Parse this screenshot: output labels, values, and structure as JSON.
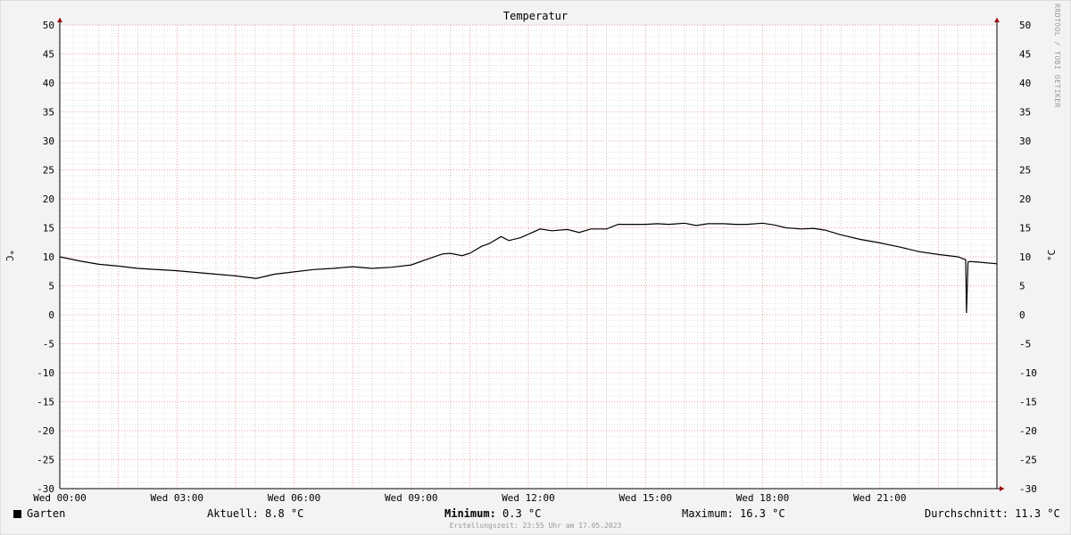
{
  "chart_data": {
    "type": "line",
    "title": "Temperatur",
    "ylabel": "°C",
    "ylim": [
      -30,
      50
    ],
    "yticks": [
      50,
      45,
      40,
      35,
      30,
      25,
      20,
      15,
      10,
      5,
      0,
      -5,
      -10,
      -15,
      -20,
      -25,
      -30
    ],
    "xlim": [
      0,
      24
    ],
    "xticks": [
      {
        "hour": 0,
        "label": "Wed 00:00"
      },
      {
        "hour": 3,
        "label": "Wed 03:00"
      },
      {
        "hour": 6,
        "label": "Wed 06:00"
      },
      {
        "hour": 9,
        "label": "Wed 09:00"
      },
      {
        "hour": 12,
        "label": "Wed 12:00"
      },
      {
        "hour": 15,
        "label": "Wed 15:00"
      },
      {
        "hour": 18,
        "label": "Wed 18:00"
      },
      {
        "hour": 21,
        "label": "Wed 21:00"
      }
    ],
    "grid": true,
    "series": [
      {
        "name": "Garten",
        "color": "#000000",
        "x": [
          0,
          0.5,
          1,
          1.5,
          2,
          3,
          4,
          4.5,
          5,
          5.05,
          5.5,
          6,
          6.5,
          7,
          7.5,
          8,
          8.5,
          9,
          9.5,
          9.8,
          10,
          10.3,
          10.5,
          10.8,
          11,
          11.3,
          11.5,
          11.8,
          12,
          12.3,
          12.6,
          13,
          13.3,
          13.6,
          14,
          14.3,
          14.6,
          15,
          15.3,
          15.6,
          16,
          16.3,
          16.6,
          17,
          17.3,
          17.6,
          18,
          18.3,
          18.6,
          19,
          19.3,
          19.6,
          20,
          20.5,
          21,
          21.5,
          22,
          22.5,
          23,
          23.2,
          23.22,
          23.26,
          23.3,
          23.5,
          24
        ],
        "values": [
          10,
          9.3,
          8.7,
          8.4,
          8.0,
          7.6,
          7.0,
          6.7,
          6.3,
          6.3,
          7.0,
          7.4,
          7.8,
          8.0,
          8.3,
          8.0,
          8.2,
          8.6,
          9.8,
          10.5,
          10.6,
          10.2,
          10.6,
          11.8,
          12.3,
          13.5,
          12.8,
          13.3,
          13.9,
          14.8,
          14.5,
          14.7,
          14.2,
          14.8,
          14.8,
          15.6,
          15.6,
          15.6,
          15.7,
          15.6,
          15.8,
          15.4,
          15.7,
          15.7,
          15.6,
          15.6,
          15.8,
          15.5,
          15.0,
          14.8,
          14.9,
          14.6,
          13.8,
          13.0,
          12.4,
          11.7,
          10.9,
          10.4,
          10.0,
          9.5,
          0.3,
          9.1,
          9.2,
          9.1,
          8.8
        ]
      }
    ],
    "legend": {
      "name": "Garten",
      "aktuell_label": "Aktuell:",
      "aktuell_value": "8.8 °C",
      "minimum_label": "Minimum:",
      "minimum_value": "0.3 °C",
      "maximum_label": "Maximum:",
      "maximum_value": "16.3 °C",
      "durchschnitt_label": "Durchschnitt:",
      "durchschnitt_value": "11.3 °C"
    },
    "footer": "Erstellungszeit: 23:55 Uhr am 17.05.2023",
    "watermark": "RRDTOOL / TOBI OETIKER"
  }
}
